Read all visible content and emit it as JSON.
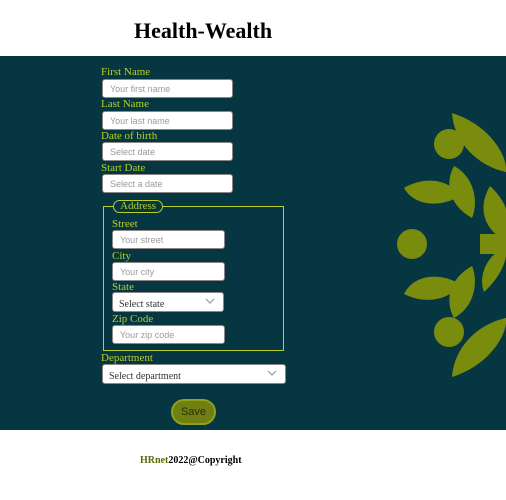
{
  "app": {
    "title": "Health-Wealth"
  },
  "form": {
    "first_name": {
      "label": "First Name",
      "placeholder": "Your first name"
    },
    "last_name": {
      "label": "Last Name",
      "placeholder": "Your last name"
    },
    "dob": {
      "label": "Date of birth",
      "placeholder": "Select date"
    },
    "start_date": {
      "label": "Start Date",
      "placeholder": "Select a date"
    },
    "address": {
      "legend": "Address",
      "street": {
        "label": "Street",
        "placeholder": "Your street"
      },
      "city": {
        "label": "City",
        "placeholder": "Your city"
      },
      "state": {
        "label": "State",
        "value": "Select state"
      },
      "zip": {
        "label": "Zip Code",
        "placeholder": "Your zip code"
      }
    },
    "department": {
      "label": "Department",
      "value": "Select department"
    },
    "save_label": "Save"
  },
  "footer": {
    "brand": "HRnet",
    "copyright": "2022@Copyright"
  },
  "colors": {
    "background": "#053642",
    "accent": "#b9cf2a",
    "button": "#6f7f12",
    "decor": "#7a8c0e"
  },
  "icons": {
    "select": "chevron-down-icon",
    "decor": "leaf-ornament"
  }
}
